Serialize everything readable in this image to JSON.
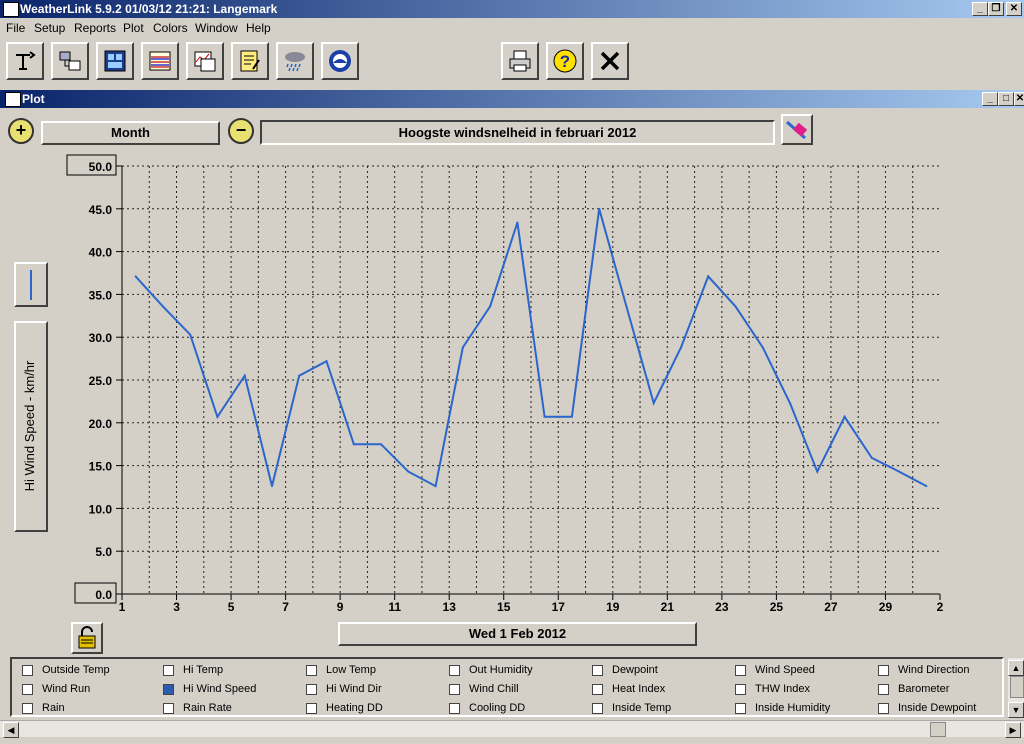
{
  "window": {
    "title": "WeatherLink 5.9.2  01/03/12  21:21: Langemark"
  },
  "menu": [
    "File",
    "Setup",
    "Reports",
    "Plot",
    "Colors",
    "Window",
    "Help"
  ],
  "toolbar": {
    "buttons": [
      "station-icon",
      "download-icon",
      "bulletin-icon",
      "strip-chart-icon",
      "plot-icon",
      "notes-icon",
      "rain-icon",
      "noaa-icon",
      "print-icon",
      "help-icon",
      "close-icon"
    ]
  },
  "plot_window": {
    "title": "Plot",
    "span_label": "Month",
    "date_label": "Wed 1 Feb 2012"
  },
  "chart_data": {
    "type": "line",
    "title": "Hoogste windsnelheid in februari 2012",
    "ylabel": "Hi Wind Speed - km/hr",
    "xlabel": "",
    "ylim": [
      0,
      50
    ],
    "yticks": [
      "0.0",
      "5.0",
      "10.0",
      "15.0",
      "20.0",
      "25.0",
      "30.0",
      "35.0",
      "40.0",
      "45.0",
      "50.0"
    ],
    "xlim": [
      1,
      31
    ],
    "xticks": [
      "1",
      "3",
      "5",
      "7",
      "9",
      "11",
      "13",
      "15",
      "17",
      "19",
      "21",
      "23",
      "25",
      "27",
      "29",
      "2"
    ],
    "grid": true,
    "line_color": "#2a66cc",
    "series": [
      {
        "x": [
          1.5,
          2.5,
          3.5,
          4.5,
          5.5,
          6.5,
          7.5,
          8.5,
          9.5,
          10.5,
          11.5,
          12.5,
          13.5,
          14.5,
          15.5,
          16.5,
          17.5,
          18.5,
          19.5,
          20.5,
          21.5,
          22.5,
          23.5,
          24.5,
          25.5,
          26.5,
          27.5,
          28.5,
          29.5,
          30.5
        ],
        "values": [
          37.1,
          33.6,
          30.3,
          20.7,
          25.5,
          12.6,
          25.5,
          27.2,
          17.5,
          17.5,
          14.3,
          12.6,
          28.8,
          33.6,
          43.4,
          20.7,
          20.7,
          45.0,
          33.6,
          22.3,
          28.8,
          37.1,
          33.6,
          28.8,
          22.3,
          14.3,
          20.7,
          15.9,
          14.3,
          12.6
        ]
      }
    ]
  },
  "legend": {
    "items": [
      {
        "label": "Outside Temp",
        "checked": false
      },
      {
        "label": "Hi Temp",
        "checked": false
      },
      {
        "label": "Low Temp",
        "checked": false
      },
      {
        "label": "Out Humidity",
        "checked": false
      },
      {
        "label": "Dewpoint",
        "checked": false
      },
      {
        "label": "Wind Speed",
        "checked": false
      },
      {
        "label": "Wind Direction",
        "checked": false
      },
      {
        "label": "Wind Run",
        "checked": false
      },
      {
        "label": "Hi Wind Speed",
        "checked": true
      },
      {
        "label": "Hi Wind Dir",
        "checked": false
      },
      {
        "label": "Wind Chill",
        "checked": false
      },
      {
        "label": "Heat Index",
        "checked": false
      },
      {
        "label": "THW Index",
        "checked": false
      },
      {
        "label": "Barometer",
        "checked": false
      },
      {
        "label": "Rain",
        "checked": false
      },
      {
        "label": "Rain Rate",
        "checked": false
      },
      {
        "label": "Heating DD",
        "checked": false
      },
      {
        "label": "Cooling DD",
        "checked": false
      },
      {
        "label": "Inside Temp",
        "checked": false
      },
      {
        "label": "Inside Humidity",
        "checked": false
      },
      {
        "label": "Inside Dewpoint",
        "checked": false
      }
    ]
  }
}
